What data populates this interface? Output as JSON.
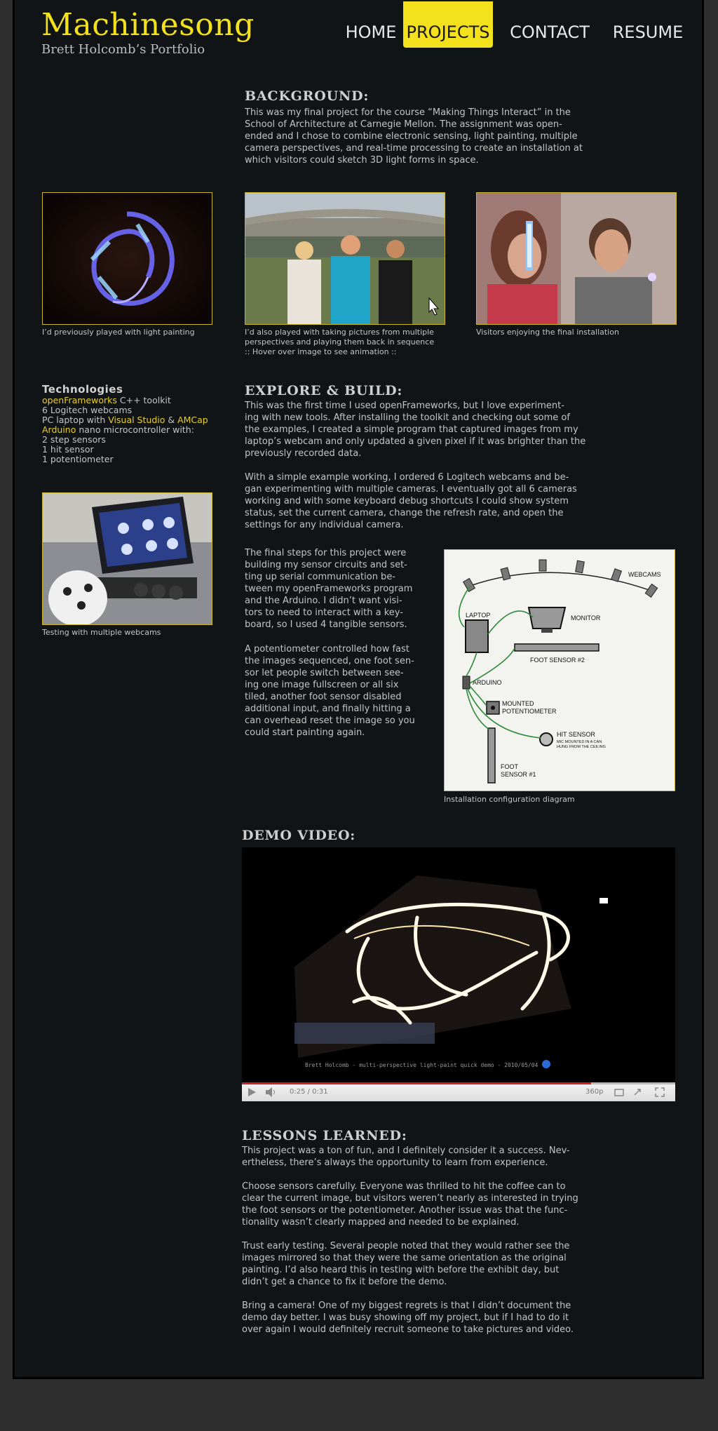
{
  "header": {
    "logo_title": "Machinesong",
    "logo_subtitle": "Brett Holcomb’s Portfolio",
    "nav": [
      {
        "label": "HOME",
        "active": false
      },
      {
        "label": "PROJECTS",
        "active": true
      },
      {
        "label": "CONTACT",
        "active": false
      },
      {
        "label": "RESUME",
        "active": false
      }
    ]
  },
  "background": {
    "title": "BACKGROUND:",
    "lines": [
      "This was my final project for the course “Making Things Interact” in the",
      "School of Architecture at Carnegie Mellon. The assignment was open-",
      "ended and I chose to combine electronic sensing, light painting, multiple",
      "camera perspectives, and real-time processing to create an installation at",
      "which visitors could sketch 3D light forms in space."
    ]
  },
  "gallery": [
    {
      "caption_lines": [
        "I’d previously played with light painting"
      ]
    },
    {
      "caption_lines": [
        "I’d also played with taking pictures from multiple",
        "perspectives and playing them back in sequence",
        ":: Hover over image to see animation ::"
      ]
    },
    {
      "caption_lines": [
        "Visitors enjoying the final installation"
      ]
    }
  ],
  "technologies": {
    "title": "Technologies",
    "lines": [
      [
        {
          "t": "openFrameworks",
          "hl": true
        },
        {
          "t": " C++ toolkit",
          "hl": false
        }
      ],
      [
        {
          "t": "6 Logitech webcams",
          "hl": false
        }
      ],
      [
        {
          "t": "PC laptop with ",
          "hl": false
        },
        {
          "t": "Visual Studio",
          "hl": true
        },
        {
          "t": " & ",
          "hl": false
        },
        {
          "t": "AMCap",
          "hl": true
        }
      ],
      [
        {
          "t": "Arduino",
          "hl": true
        },
        {
          "t": " nano microcontroller with:",
          "hl": false
        }
      ],
      [
        {
          "t": "2 step sensors",
          "hl": false
        }
      ],
      [
        {
          "t": "1 hit sensor",
          "hl": false
        }
      ],
      [
        {
          "t": "1 potentiometer",
          "hl": false
        }
      ]
    ],
    "photo_caption": "Testing with multiple webcams"
  },
  "explore": {
    "title": "EXPLORE & BUILD:",
    "para1": [
      "This was the first time I used openFrameworks, but I love experiment-",
      "ing with new tools. After installing the toolkit and checking out some of",
      "the examples, I created a simple program that captured images from my",
      "laptop’s webcam and only updated a given pixel if it was brighter than the",
      "previously recorded data."
    ],
    "para2": [
      "With a simple example working, I ordered 6 Logitech webcams and be-",
      "gan experimenting with multiple cameras. I eventually got all 6 cameras",
      "working and with some keyboard debug shortcuts I could show system",
      "status, set the current camera, change the refresh rate, and open the",
      "settings for any individual camera."
    ],
    "para3": [
      "The final steps for this project were",
      "building my sensor circuits and set-",
      "ting up serial communication be-",
      "tween my openFrameworks program",
      "and the Arduino. I didn’t want visi-",
      "tors to need to interact with a key-",
      "board, so I used 4 tangible sensors."
    ],
    "para4": [
      "A potentiometer controlled how fast",
      "the images sequenced, one foot sen-",
      "sor let people switch between see-",
      "ing one image fullscreen or all six",
      "tiled, another foot sensor disabled",
      "additional input, and finally hitting a",
      "can overhead reset the image so you",
      "could start painting again."
    ],
    "diagram_caption": "Installation configuration diagram",
    "diagram_labels": {
      "webcams": "WEBCAMS",
      "laptop": "LAPTOP",
      "monitor": "MONITOR",
      "foot2": "FOOT SENSOR #2",
      "arduino": "ARDUINO",
      "pot1": "MOUNTED",
      "pot2": "POTENTIOMETER",
      "hit": "HIT SENSOR",
      "hit_sub1": "MIC MOUNTED IN A CAN",
      "hit_sub2": "HUNG FROM THE CEILING",
      "foot1a": "FOOT",
      "foot1b": "SENSOR #1"
    }
  },
  "demo": {
    "title": "DEMO VIDEO:",
    "video_caption": "Brett Holcomb - multi-perspective light-paint quick demo - 2010/05/04",
    "time": "0:25 / 0:31",
    "quality": "360p",
    "progress": 0.806
  },
  "lessons": {
    "title": "LESSONS LEARNED:",
    "paras": [
      [
        "This project was a ton of fun, and I definitely consider it a success. Nev-",
        "ertheless, there’s always the opportunity to learn from experience."
      ],
      [
        "Choose sensors carefully. Everyone was thrilled to hit the coffee can to",
        "clear the current image, but visitors weren’t nearly as interested in trying",
        "the foot sensors or the potentiometer. Another issue was that the func-",
        "tionality wasn’t clearly mapped and needed to be explained."
      ],
      [
        "Trust early testing. Several people noted that they would rather see the",
        "images mirrored so that they were the same orientation as the original",
        "painting. I’d also heard this in testing with before the exhibit day, but",
        "didn’t get a chance to fix it before the demo."
      ],
      [
        "Bring a camera! One of my biggest regrets is that I didn’t document the",
        "demo day better. I was busy showing off my project, but if I had to do it",
        "over again I would definitely recruit someone to take pictures and video."
      ]
    ]
  },
  "colors": {
    "accent": "#f4e11e",
    "page_bg": "#111416",
    "outer_bg": "#2e2e2e"
  }
}
